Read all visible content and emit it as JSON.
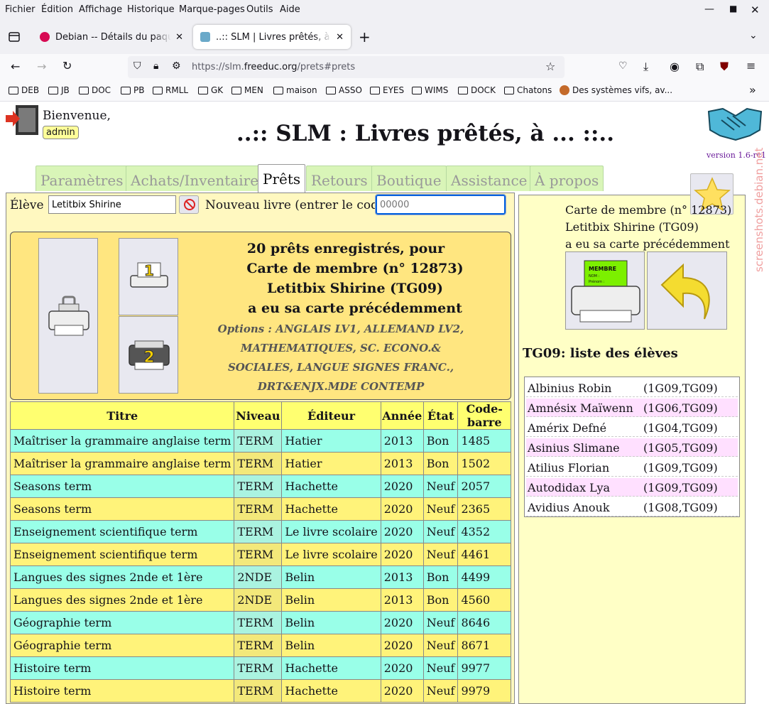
{
  "menubar": {
    "items": [
      "Fichier",
      "Édition",
      "Affichage",
      "Historique",
      "Marque-pages",
      "Outils",
      "Aide"
    ]
  },
  "tabs": [
    {
      "label": "Debian -- Détails du paquet sl"
    },
    {
      "label": "..:: SLM | Livres prêtés, à ... ::.."
    }
  ],
  "nav": {
    "url_prefix": "https://slm.",
    "url_domain": "freeduc.org",
    "url_path": "/prets#prets"
  },
  "bookmarks": [
    "DEB",
    "JB",
    "DOC",
    "PB",
    "RMLL",
    "GK",
    "MEN",
    "maison",
    "ASSO",
    "EYES",
    "WIMS",
    "DOCK",
    "Chatons",
    "Des systèmes vifs, av..."
  ],
  "page": {
    "welcome": "Bienvenue,",
    "user": "admin",
    "title": "..:: SLM : Livres prêtés, à ... ::..",
    "version": "version 1.6-rc1",
    "navtabs": [
      "Paramètres",
      "Achats/Inventaire",
      "Prêts",
      "Retours",
      "Boutique",
      "Assistance",
      "À propos"
    ],
    "eleve_label": "Élève :",
    "eleve_value": "Letitbix Shirine",
    "newbook_label": "Nouveau livre (entrer le code) :",
    "code_placeholder": "00000",
    "info": {
      "line1": "20 prêts enregistrés, pour",
      "line2": "Carte de membre (n° 12873)",
      "line3": "Letitbix Shirine (TG09)",
      "line4": "a eu sa carte précédemment",
      "options": "Options : ANGLAIS LV1, ALLEMAND LV2, MATHEMATIQUES, SC. ECONO.& SOCIALES, LANGUE SIGNES FRANC., DRT&ENJX.MDE CONTEMP"
    },
    "print_labels": {
      "one": "1",
      "two": "2"
    },
    "table": {
      "headers": [
        "Titre",
        "Niveau",
        "Éditeur",
        "Année",
        "État",
        "Code-barre"
      ],
      "rows": [
        [
          "Maîtriser la grammaire anglaise term",
          "TERM",
          "Hatier",
          "2013",
          "Bon",
          "1485"
        ],
        [
          "Maîtriser la grammaire anglaise term",
          "TERM",
          "Hatier",
          "2013",
          "Bon",
          "1502"
        ],
        [
          "Seasons term",
          "TERM",
          "Hachette",
          "2020",
          "Neuf",
          "2057"
        ],
        [
          "Seasons term",
          "TERM",
          "Hachette",
          "2020",
          "Neuf",
          "2365"
        ],
        [
          "Enseignement scientifique term",
          "TERM",
          "Le livre scolaire",
          "2020",
          "Neuf",
          "4352"
        ],
        [
          "Enseignement scientifique term",
          "TERM",
          "Le livre scolaire",
          "2020",
          "Neuf",
          "4461"
        ],
        [
          "Langues des signes 2nde et 1ère",
          "2NDE",
          "Belin",
          "2013",
          "Bon",
          "4499"
        ],
        [
          "Langues des signes 2nde et 1ère",
          "2NDE",
          "Belin",
          "2013",
          "Bon",
          "4560"
        ],
        [
          "Géographie term",
          "TERM",
          "Belin",
          "2020",
          "Neuf",
          "8646"
        ],
        [
          "Géographie term",
          "TERM",
          "Belin",
          "2020",
          "Neuf",
          "8671"
        ],
        [
          "Histoire term",
          "TERM",
          "Hachette",
          "2020",
          "Neuf",
          "9977"
        ],
        [
          "Histoire term",
          "TERM",
          "Hachette",
          "2020",
          "Neuf",
          "9979"
        ]
      ]
    },
    "card": {
      "line1": "Carte de membre (n° 12873)",
      "line2": "Letitbix Shirine (TG09)",
      "line3": "a eu sa carte précédemment",
      "badge": "MEMBRE",
      "nom": "NOM :",
      "prenom": "Prénom :"
    },
    "class_title": "TG09: liste des élèves",
    "students": [
      {
        "name": "Albinius Robin",
        "classes": "(1G09,TG09)"
      },
      {
        "name": "Amnésix Maïwenn",
        "classes": "(1G06,TG09)"
      },
      {
        "name": "Amérix Defné",
        "classes": "(1G04,TG09)"
      },
      {
        "name": "Asinius Slimane",
        "classes": "(1G05,TG09)"
      },
      {
        "name": "Atilius Florian",
        "classes": "(1G09,TG09)"
      },
      {
        "name": "Autodidax Lya",
        "classes": "(1G09,TG09)"
      },
      {
        "name": "Avidius Anouk",
        "classes": "(1G08,TG09)"
      }
    ],
    "watermark": "screenshots.debian.net"
  },
  "colors": {
    "accent": "#0060df",
    "odd_row": "#99ffe8",
    "even_row": "#fff37a",
    "panel": "#ffe680"
  }
}
